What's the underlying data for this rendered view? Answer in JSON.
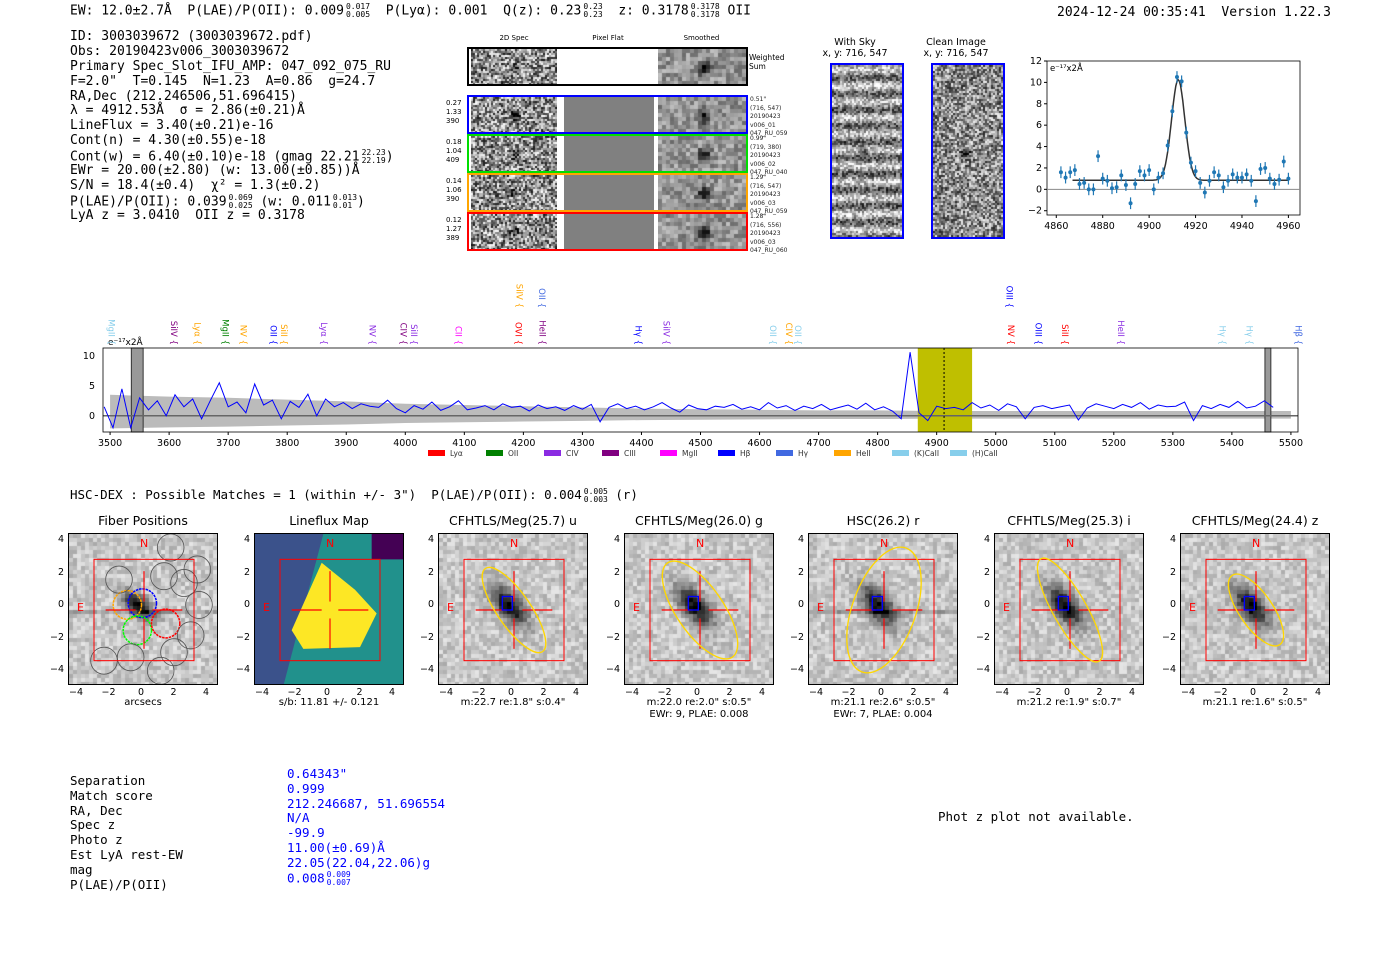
{
  "header": {
    "ew": "EW: 12.0±2.7Å",
    "plae_label": "P(LAE)/P(OII): 0.009",
    "plae_hi": "0.017",
    "plae_lo": "0.005",
    "plya": "P(Lyα): 0.001",
    "qz_label": "Q(z): 0.23",
    "qz_hi": "0.23",
    "qz_lo": "0.23",
    "z_label": "z: 0.3178",
    "z_hi": "0.3178",
    "z_lo": "0.3178",
    "z_line": "OII",
    "datetime": "2024-12-24 00:35:41",
    "version": "Version 1.22.3"
  },
  "info": [
    {
      "text": "ID: 3003039672 (3003039672.pdf)"
    },
    {
      "text": "Obs: 20190423v006_3003039672"
    },
    {
      "text": "Primary Spec_Slot_IFU_AMP: 047_092_075_RU"
    },
    {
      "text": "F=2.0\"  T=0.145  N=1.23  A=0.86  g=24.7"
    },
    {
      "text": "RA,Dec (212.246506,51.696415)"
    },
    {
      "text": "λ = 4912.53Å  σ = 2.86(±0.21)Å"
    },
    {
      "text": "LineFlux = 3.40(±0.21)e-16"
    },
    {
      "text": "Cont(n) = 4.30(±0.55)e-18"
    },
    {
      "text": "Cont(w) = 6.40(±0.10)e-18 (gmag 22.21",
      "hi": "22.23",
      "lo": "22.19",
      "tail": ")"
    },
    {
      "text": "EWr = 20.00(±2.80) (w: 13.00(±0.85))Å"
    },
    {
      "text": "S/N = 18.4(±0.4)  χ² = 1.3(±0.2)"
    },
    {
      "text": "P(LAE)/P(OII): 0.039",
      "hi": "0.069",
      "lo": "0.025",
      "tail": " (w: 0.011",
      "hi2": "0.013",
      "lo2": "0.01",
      "tail2": ")"
    },
    {
      "text": "LyA z = 3.0410  OII z = 0.3178"
    }
  ],
  "spec2d": {
    "columns": [
      "2D Spec",
      "Pixel Flat",
      "Smoothed"
    ],
    "weighted_label": "Weighted Sum",
    "rows": [
      {
        "color": "#0000ff",
        "left": [
          "0.27",
          "1.33",
          "390"
        ],
        "right": [
          "0.51\"",
          "(716, 547)",
          "20190423",
          "v006_01",
          "047_RU_059"
        ]
      },
      {
        "color": "#00dd00",
        "left": [
          "0.18",
          "1.04",
          "409"
        ],
        "right": [
          "0.99\"",
          "(719, 380)",
          "20190423",
          "v006_02",
          "047_RU_040"
        ]
      },
      {
        "color": "#ffa500",
        "left": [
          "0.14",
          "1.06",
          "390"
        ],
        "right": [
          "1.29\"",
          "(716, 547)",
          "20190423",
          "v006_03",
          "047_RU_059"
        ]
      },
      {
        "color": "#ff0000",
        "left": [
          "0.12",
          "1.27",
          "389"
        ],
        "right": [
          "1.28\"",
          "(716, 556)",
          "20190423",
          "v006_03",
          "047_RU_060"
        ]
      }
    ]
  },
  "cutouts2d": [
    {
      "title": "With Sky",
      "coords": "x, y: 716, 547"
    },
    {
      "title": "Clean Image",
      "coords": "x, y: 716, 547"
    }
  ],
  "chart_data": [
    {
      "type": "scatter",
      "title": "",
      "unit_label": "e⁻¹⁷x2Å",
      "xlim": [
        4856,
        4965
      ],
      "ylim": [
        -2.4,
        12
      ],
      "xticks": [
        4860,
        4880,
        4900,
        4920,
        4940,
        4960
      ],
      "yticks": [
        -2,
        0,
        2,
        4,
        6,
        8,
        10,
        12
      ],
      "x": [
        4862,
        4864,
        4866,
        4868,
        4870,
        4872,
        4874,
        4876,
        4878,
        4880,
        4882,
        4884,
        4886,
        4888,
        4890,
        4892,
        4894,
        4896,
        4898,
        4900,
        4902,
        4904,
        4906,
        4908,
        4910,
        4912,
        4914,
        4916,
        4918,
        4920,
        4922,
        4924,
        4926,
        4928,
        4930,
        4932,
        4934,
        4936,
        4938,
        4940,
        4942,
        4944,
        4946,
        4948,
        4950,
        4952,
        4954,
        4956,
        4958,
        4960
      ],
      "y": [
        1.6,
        1.1,
        1.6,
        1.8,
        0.5,
        0.6,
        0,
        0,
        3.1,
        1.0,
        0.8,
        0.1,
        0.2,
        1.3,
        0.4,
        -1.3,
        0.5,
        1.7,
        1.3,
        1.8,
        0,
        1.1,
        1.5,
        4.1,
        7.3,
        10.5,
        10.1,
        5.3,
        2.5,
        1.7,
        0.6,
        -0.3,
        0.8,
        1.6,
        1.3,
        0.2,
        0.8,
        1.4,
        1.1,
        1.1,
        1.4,
        0.8,
        -1.1,
        1.9,
        2.0,
        1.0,
        0.5,
        0.9,
        2.6,
        1.0
      ],
      "yerr": 0.55,
      "fit": {
        "center": 4912.53,
        "sigma": 2.86,
        "amplitude": 9.4,
        "continuum": 0.85,
        "range": [
          4867,
          4960
        ]
      },
      "colors": {
        "points": "#1f77b4",
        "fit": "#333333"
      }
    },
    {
      "type": "line",
      "title": "",
      "unit_label": "e⁻¹⁷x2Å",
      "xlim": [
        3488,
        5512
      ],
      "ylim": [
        -2.7,
        11.3
      ],
      "xticks": [
        3500,
        3600,
        3700,
        3800,
        3900,
        4000,
        4100,
        4200,
        4300,
        4400,
        4500,
        4600,
        4700,
        4800,
        4900,
        5000,
        5100,
        5200,
        5300,
        5400,
        5500
      ],
      "yticks": [
        0,
        5,
        10
      ],
      "x_start": 3490,
      "x_step": 15,
      "flux": [
        1.5,
        -2,
        4.5,
        -2,
        3,
        1,
        2.5,
        0,
        3.5,
        1.5,
        2.8,
        -0.5,
        2.6,
        5.5,
        1.5,
        2.3,
        0.5,
        5.3,
        1.8,
        2.6,
        -0.5,
        2.4,
        1.4,
        3.6,
        0,
        2.8,
        1.5,
        2.2,
        1.2,
        2.0,
        1.6,
        1.4,
        2.6,
        1.2,
        0.5,
        1.7,
        1.1,
        2.3,
        0.9,
        1.5,
        2.5,
        1.0,
        1.3,
        1.7,
        1.0,
        2.0,
        1.4,
        1.6,
        0.8,
        1.8,
        1.2,
        1.5,
        0.9,
        1.7,
        1.1,
        1.9,
        -1,
        1.4,
        2.0,
        1.2,
        1.6,
        1.0,
        1.5,
        2.2,
        1.3,
        0.6,
        1.8,
        1.2,
        1.0,
        1.6,
        1.4,
        1.9,
        1.1,
        1.5,
        1.0,
        2.2,
        1.3,
        1.7,
        0.9,
        1.6,
        1.2,
        1.9,
        1.0,
        1.4,
        1.8,
        1.1,
        2.1,
        1.0,
        1.5,
        0.8,
        -0.5,
        10.6,
        0.5,
        -0.8,
        1.6,
        1.2,
        1.4,
        1.0,
        2.2,
        1.3,
        1.8,
        0.9,
        2.0,
        1.5,
        -0.5,
        1.4,
        1.7,
        1.2,
        1.5,
        1.8,
        -0.7,
        1.3,
        2.0,
        1.6,
        1.2,
        1.9,
        1.4,
        2.2,
        1.1,
        1.8,
        1.5,
        1.6,
        2.3,
        -0.8,
        1.7,
        1.2,
        1.9,
        1.4,
        2.4,
        1.3,
        1.6,
        2.5,
        1.4
      ],
      "noise_band": [
        3.5,
        3.2,
        3.0,
        2.7,
        2.4,
        2.0,
        1.8,
        1.6,
        1.4,
        1.2,
        1.1,
        1.0,
        0.9,
        0.9,
        0.8,
        0.8,
        0.8,
        0.8,
        0.8,
        0.8,
        0.8
      ],
      "highlight": {
        "range": [
          4868,
          4960
        ],
        "color": "#bfbf00"
      },
      "masked": [
        [
          3536,
          3556
        ],
        [
          5456,
          5466
        ]
      ],
      "line_marker": 4912.53,
      "line_labels": [
        {
          "name": "MgII",
          "x": 3492,
          "color": "#87ceeb",
          "tier": 0
        },
        {
          "name": "SiIV",
          "x": 3598,
          "color": "#800080",
          "tier": 0
        },
        {
          "name": "Lyα",
          "x": 3638,
          "color": "#ffa500",
          "tier": 0
        },
        {
          "name": "MgII",
          "x": 3685,
          "color": "#008000",
          "tier": 0
        },
        {
          "name": "NV",
          "x": 3716,
          "color": "#ffa500",
          "tier": 0
        },
        {
          "name": "OII",
          "x": 3767,
          "color": "#0000ff",
          "tier": 0
        },
        {
          "name": "SiII",
          "x": 3784,
          "color": "#ffa500",
          "tier": 0
        },
        {
          "name": "Lyα",
          "x": 3852,
          "color": "#8a2be2",
          "tier": 0
        },
        {
          "name": "NV",
          "x": 3934,
          "color": "#8a2be2",
          "tier": 0
        },
        {
          "name": "CIV",
          "x": 3987,
          "color": "#800080",
          "tier": 0
        },
        {
          "name": "SiII",
          "x": 4005,
          "color": "#8a2be2",
          "tier": 0
        },
        {
          "name": "CII",
          "x": 4080,
          "color": "#ff00ff",
          "tier": 0
        },
        {
          "name": "SiIV",
          "x": 4183,
          "color": "#ffa500",
          "tier": 1
        },
        {
          "name": "OVI",
          "x": 4182,
          "color": "#ff0000",
          "tier": 0
        },
        {
          "name": "OII",
          "x": 4221,
          "color": "#4169e1",
          "tier": 1
        },
        {
          "name": "HeII",
          "x": 4222,
          "color": "#800080",
          "tier": 0
        },
        {
          "name": "Hγ",
          "x": 4385,
          "color": "#0000ff",
          "tier": 0
        },
        {
          "name": "SiIV",
          "x": 4432,
          "color": "#8a2be2",
          "tier": 0
        },
        {
          "name": "OII",
          "x": 4613,
          "color": "#87ceeb",
          "tier": 0
        },
        {
          "name": "CIV",
          "x": 4640,
          "color": "#ffa500",
          "tier": 0
        },
        {
          "name": "OII",
          "x": 4655,
          "color": "#87ceeb",
          "tier": 0
        },
        {
          "name": "OIII",
          "x": 5013,
          "color": "#0000ff",
          "tier": 1
        },
        {
          "name": "NV",
          "x": 5016,
          "color": "#ff0000",
          "tier": 0
        },
        {
          "name": "OIII",
          "x": 5062,
          "color": "#0000ff",
          "tier": 0
        },
        {
          "name": "SiII",
          "x": 5107,
          "color": "#ff0000",
          "tier": 0
        },
        {
          "name": "HeII",
          "x": 5202,
          "color": "#8a2be2",
          "tier": 0
        },
        {
          "name": "Hγ",
          "x": 5374,
          "color": "#87ceeb",
          "tier": 0
        },
        {
          "name": "Hγ",
          "x": 5420,
          "color": "#87ceeb",
          "tier": 0
        },
        {
          "name": "Hβ",
          "x": 5503,
          "color": "#4169e1",
          "tier": 0
        }
      ],
      "legend": [
        {
          "name": "Lyα",
          "color": "#ff0000"
        },
        {
          "name": "OII",
          "color": "#008000"
        },
        {
          "name": "CIV",
          "color": "#8a2be2"
        },
        {
          "name": "CIII",
          "color": "#800080"
        },
        {
          "name": "MgII",
          "color": "#ff00ff"
        },
        {
          "name": "Hβ",
          "color": "#0000ff"
        },
        {
          "name": "Hγ",
          "color": "#4169e1"
        },
        {
          "name": "HeII",
          "color": "#ffa500"
        },
        {
          "name": "(K)CaII",
          "color": "#87ceeb"
        },
        {
          "name": "(H)CaII",
          "color": "#87ceeb"
        }
      ],
      "colors": {
        "flux": "#0000ff",
        "noise": "#bbbbbb"
      }
    }
  ],
  "match_line": {
    "text": "HSC-DEX : Possible Matches = 1 (within +/- 3\")  P(LAE)/P(OII): 0.004",
    "hi": "0.005",
    "lo": "0.003",
    "tail": " (r)"
  },
  "panels": [
    {
      "title": "Fiber Positions",
      "label1": "arcsecs",
      "label2": "",
      "kind": "fiber"
    },
    {
      "title": "Lineflux Map",
      "label1": "s/b: 11.81 +/- 0.121",
      "label2": "",
      "kind": "flux"
    },
    {
      "title": "CFHTLS/Meg(25.7) u",
      "label1": "m:22.7  re:1.8\"  s:0.4\"",
      "label2": "",
      "kind": "img",
      "ell": [
        1.0,
        3.0,
        35
      ]
    },
    {
      "title": "CFHTLS/Meg(26.0) g",
      "label1": "m:22.0  re:2.0\"  s:0.5\"",
      "label2": "EWr: 9, PLAE: 0.008",
      "kind": "img",
      "ell": [
        1.4,
        3.4,
        35
      ]
    },
    {
      "title": "HSC(26.2) r",
      "label1": "m:21.1  re:2.6\"  s:0.5\"",
      "label2": "EWr: 7, PLAE: 0.004",
      "kind": "img",
      "ell": [
        1.9,
        3.9,
        -20
      ]
    },
    {
      "title": "CFHTLS/Meg(25.3) i",
      "label1": "m:21.2  re:1.9\"  s:0.7\"",
      "label2": "",
      "kind": "img",
      "ell": [
        1.0,
        3.5,
        30
      ]
    },
    {
      "title": "CFHTLS/Meg(24.4) z",
      "label1": "m:21.1  re:1.6\"  s:0.5\"",
      "label2": "",
      "kind": "img",
      "ell": [
        1.0,
        2.5,
        35
      ]
    }
  ],
  "panel_marks": {
    "north": "N",
    "east": "E",
    "ticks": [
      "−4",
      "−2",
      "0",
      "2",
      "4"
    ],
    "yticks": [
      "4",
      "2",
      "0",
      "−2",
      "−4"
    ]
  },
  "match_table": {
    "labels": [
      "Separation",
      "Match score",
      "RA, Dec",
      "Spec z",
      "Photo z",
      "Est LyA rest-EW",
      "mag",
      "P(LAE)/P(OII)"
    ],
    "values": [
      "0.64343\"",
      "0.999",
      "212.246687, 51.696554",
      "N/A",
      "-99.9",
      "11.00(±0.69)Å",
      "22.05(22.04,22.06)g",
      "0.008"
    ],
    "plae_hi": "0.009",
    "plae_lo": "0.007"
  },
  "photz_message": "Phot z plot not available."
}
